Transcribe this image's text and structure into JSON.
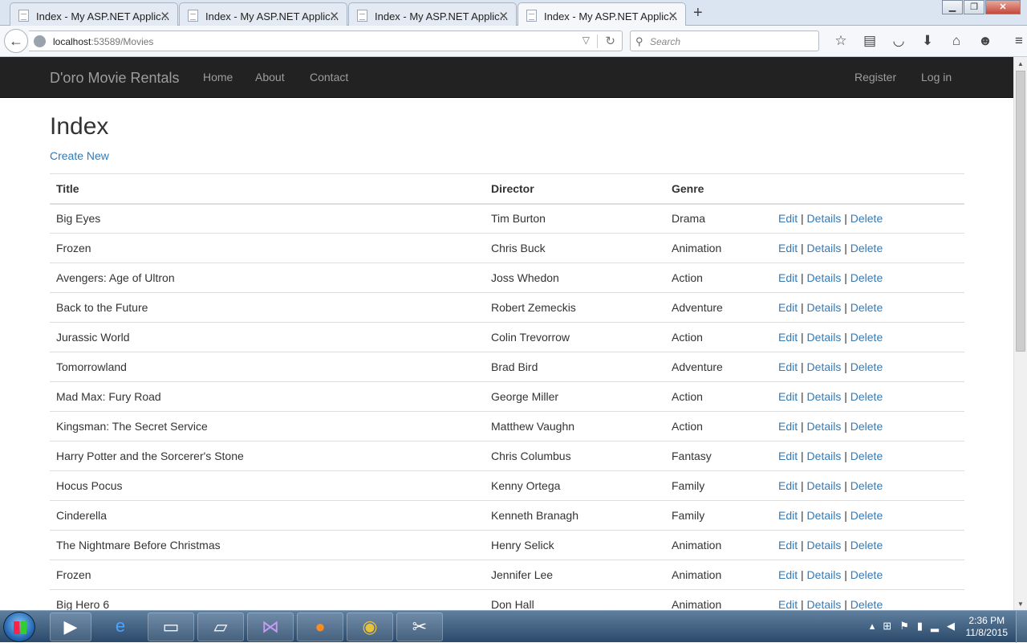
{
  "browser": {
    "tabs": [
      {
        "label": "Index - My ASP.NET Applic..."
      },
      {
        "label": "Index - My ASP.NET Applic..."
      },
      {
        "label": "Index - My ASP.NET Applic..."
      },
      {
        "label": "Index - My ASP.NET Applic..."
      }
    ],
    "url_host": "localhost",
    "url_path": ":53589/Movies",
    "search_placeholder": "Search"
  },
  "site": {
    "brand": "D'oro Movie Rentals",
    "nav": {
      "home": "Home",
      "about": "About",
      "contact": "Contact"
    },
    "account": {
      "register": "Register",
      "login": "Log in"
    }
  },
  "page": {
    "title": "Index",
    "create_new": "Create New"
  },
  "table": {
    "headers": {
      "title": "Title",
      "director": "Director",
      "genre": "Genre"
    },
    "actions": {
      "edit": "Edit",
      "details": "Details",
      "delete": "Delete",
      "sep": "|"
    },
    "rows": [
      {
        "title": "Big Eyes",
        "director": "Tim Burton",
        "genre": "Drama"
      },
      {
        "title": "Frozen",
        "director": "Chris Buck",
        "genre": "Animation"
      },
      {
        "title": "Avengers: Age of Ultron",
        "director": "Joss Whedon",
        "genre": "Action"
      },
      {
        "title": "Back to the Future",
        "director": "Robert Zemeckis",
        "genre": "Adventure"
      },
      {
        "title": "Jurassic World",
        "director": "Colin Trevorrow",
        "genre": "Action"
      },
      {
        "title": "Tomorrowland",
        "director": "Brad Bird",
        "genre": "Adventure"
      },
      {
        "title": "Mad Max: Fury Road",
        "director": "George Miller",
        "genre": "Action"
      },
      {
        "title": "Kingsman: The Secret Service",
        "director": "Matthew Vaughn",
        "genre": "Action"
      },
      {
        "title": "Harry Potter and the Sorcerer's Stone",
        "director": "Chris Columbus",
        "genre": "Fantasy"
      },
      {
        "title": "Hocus Pocus",
        "director": "Kenny Ortega",
        "genre": "Family"
      },
      {
        "title": "Cinderella",
        "director": "Kenneth Branagh",
        "genre": "Family"
      },
      {
        "title": "The Nightmare Before Christmas",
        "director": "Henry Selick",
        "genre": "Animation"
      },
      {
        "title": "Frozen",
        "director": "Jennifer Lee",
        "genre": "Animation"
      },
      {
        "title": "Big Hero 6",
        "director": "Don Hall",
        "genre": "Animation"
      }
    ]
  },
  "taskbar": {
    "time": "2:36 PM",
    "date": "11/8/2015"
  },
  "colors": {
    "navbar_bg": "#222222",
    "link": "#337ab7",
    "nav_text": "#9d9d9d"
  }
}
